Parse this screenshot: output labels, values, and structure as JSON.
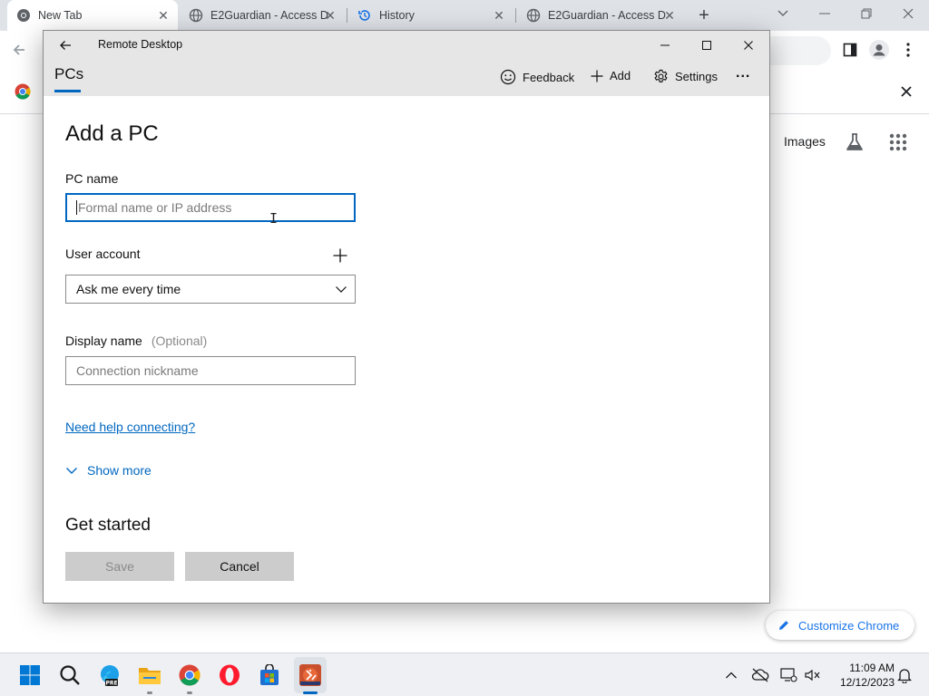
{
  "chrome": {
    "tabs": [
      {
        "title": "New Tab",
        "active": true
      },
      {
        "title": "E2Guardian - Access D",
        "active": false
      },
      {
        "title": "History",
        "active": false
      },
      {
        "title": "E2Guardian - Access D",
        "active": false
      }
    ],
    "ntp": {
      "images_link": "Images",
      "customize_label": "Customize Chrome"
    }
  },
  "remote_desktop": {
    "window_title": "Remote Desktop",
    "nav_tab": "PCs",
    "actions": {
      "feedback": "Feedback",
      "add": "Add",
      "settings": "Settings",
      "more": "..."
    },
    "form": {
      "heading": "Add a PC",
      "pc_name_label": "PC name",
      "pc_name_placeholder": "Formal name or IP address",
      "user_account_label": "User account",
      "user_account_value": "Ask me every time",
      "display_name_label": "Display name",
      "display_name_optional": "(Optional)",
      "display_name_placeholder": "Connection nickname",
      "help_link": "Need help connecting?",
      "show_more": "Show more",
      "get_started": "Get started",
      "save_label": "Save",
      "cancel_label": "Cancel"
    }
  },
  "taskbar": {
    "apps": [
      "start",
      "search",
      "edge-beta",
      "file-explorer",
      "chrome",
      "opera",
      "microsoft-store",
      "remote-desktop"
    ],
    "clock_time": "11:09 AM",
    "clock_date": "12/12/2023"
  },
  "colors": {
    "accent": "#0067c0",
    "titlebar": "#e6e6e6",
    "button_gray": "#cccccc",
    "chrome_link": "#1a73e8"
  }
}
